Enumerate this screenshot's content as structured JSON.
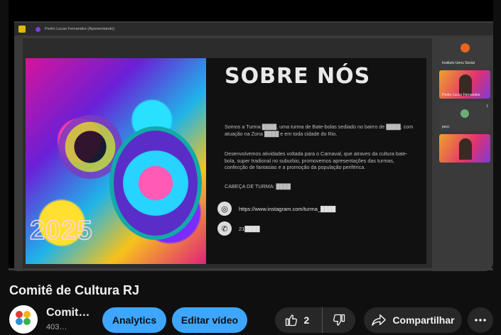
{
  "meet": {
    "presenter": "Pedro Lucas Fernandes (Apresentando)",
    "participants": [
      {
        "label": "Instituto Uenu Social",
        "badge": ""
      },
      {
        "label": "Pedro Lucas Fernandes",
        "badge": ""
      },
      {
        "label": "pecc",
        "badge": "1"
      },
      {
        "label": "",
        "badge": ""
      }
    ]
  },
  "slide": {
    "heading": "SOBRE NÓS",
    "para1": "Somos a Turma ████, uma turma de Bate-bolas sediado no bairro de ████, com atuação na Zona ████ e em toda cidade do Rio.",
    "para2": "Desenvolvemos atividades voltada para o Carnaval, que atraves da cultura bate-bola, super tradional no suburbio, promovemos apresentações das turmas, confecção de fantasias e a promoção da população periférica.",
    "para3": "CABEÇA DE TURMA: ████",
    "instagram": "https://www.instagram.com/turma_████",
    "phone": "21████",
    "year": "2025"
  },
  "video": {
    "title": "Comitê de Cultura RJ"
  },
  "channel": {
    "name": "Comit…",
    "subs": "403…"
  },
  "actions": {
    "analytics": "Analytics",
    "edit": "Editar vídeo",
    "likes": "2",
    "share": "Compartilhar"
  },
  "colors": {
    "accent_blue": "#3ea6ff",
    "background": "#0f0f0f",
    "button_grey": "#272727"
  },
  "icons": {
    "like": "thumbs-up-icon",
    "dislike": "thumbs-down-icon",
    "share": "share-arrow-icon",
    "more": "more-dots-icon",
    "instagram": "instagram-icon",
    "whatsapp": "whatsapp-icon"
  }
}
